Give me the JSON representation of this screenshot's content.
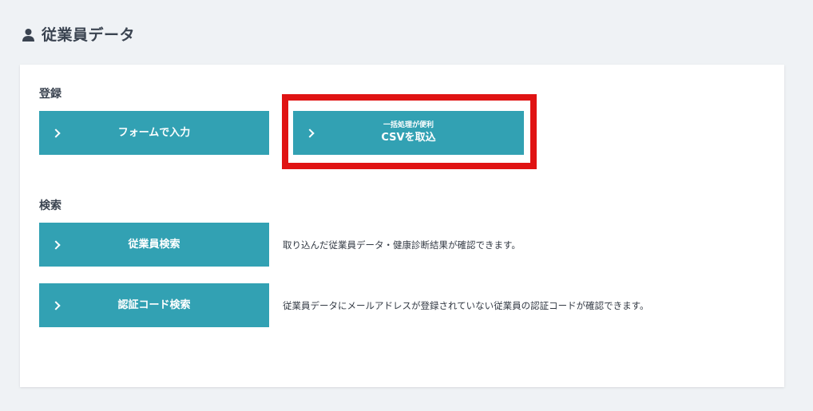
{
  "header": {
    "title": "従業員データ",
    "icon": "user-icon"
  },
  "register": {
    "label": "登録",
    "form_button": "フォームで入力",
    "csv_button_sub": "一括処理が便利",
    "csv_button": "CSVを取込"
  },
  "search": {
    "label": "検索",
    "employee_button": "従業員検索",
    "employee_desc": "取り込んだ従業員データ・健康診断結果が確認できます。",
    "auth_button": "認証コード検索",
    "auth_desc": "従業員データにメールアドレスが登録されていない従業員の認証コードが確認できます。"
  },
  "colors": {
    "button": "#32a1b3",
    "highlight": "#e01313",
    "background": "#eff2f5"
  }
}
